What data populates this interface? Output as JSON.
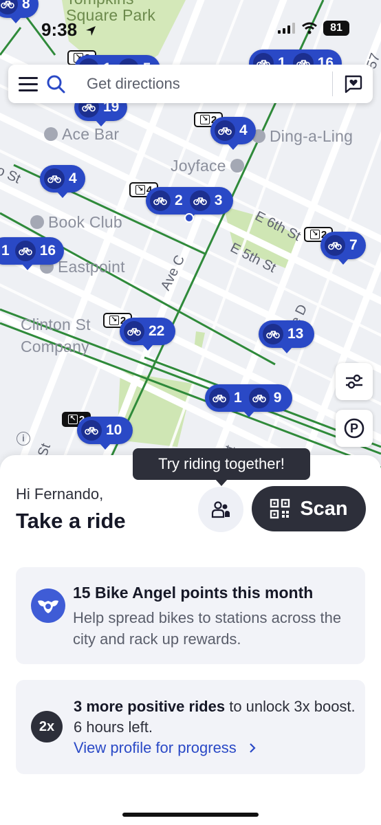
{
  "status_bar": {
    "time": "9:38",
    "battery": "81"
  },
  "search": {
    "placeholder": "Get directions"
  },
  "map": {
    "places": {
      "park": "Tompkins\nSquare Park",
      "ace_bar": "Ace Bar",
      "ding_a_ling": "Ding-a-Ling",
      "joyface": "Joyface",
      "book_club": "Book Club",
      "eastpoint": "Eastpoint",
      "clinton_1": "Clinton St",
      "clinton_2": "Company"
    },
    "streets": {
      "e6th": "E 6th St",
      "e5th": "E 5th St",
      "avec": "Ave C",
      "aved": "ve D",
      "st_left": "o St",
      "st_bottom1": "e St",
      "st_bottom2": "St",
      "s7": "57"
    },
    "stations": [
      {
        "id": "tl",
        "counts": [
          "8"
        ]
      },
      {
        "id": "top",
        "badge": "2",
        "counts": [
          "1",
          "5"
        ]
      },
      {
        "id": "topright",
        "counts": [
          "1",
          "16"
        ]
      },
      {
        "id": "s19",
        "counts": [
          "19"
        ]
      },
      {
        "id": "s4a",
        "badge": "2",
        "counts": [
          "4"
        ]
      },
      {
        "id": "s4b",
        "counts": [
          "4"
        ]
      },
      {
        "id": "s23",
        "badge": "4",
        "counts": [
          "2",
          "3"
        ]
      },
      {
        "id": "s16",
        "counts": [
          "1",
          "16"
        ]
      },
      {
        "id": "s7",
        "badge": "2",
        "counts": [
          "7"
        ]
      },
      {
        "id": "s22",
        "badge": "2",
        "counts": [
          "22"
        ]
      },
      {
        "id": "s13",
        "counts": [
          "13"
        ]
      },
      {
        "id": "s19b",
        "counts": [
          "1",
          "9"
        ]
      },
      {
        "id": "s10",
        "badge": "2",
        "counts": [
          "10"
        ]
      }
    ]
  },
  "sheet": {
    "tooltip": "Try riding together!",
    "greeting": "Hi Fernando,",
    "title": "Take a ride",
    "scan_label": "Scan",
    "angel_card": {
      "title": "15 Bike Angel points this month",
      "body": "Help spread bikes to stations across the city and rack up rewards."
    },
    "boost_card": {
      "badge": "2x",
      "bold": "3 more positive rides",
      "text": " to unlock 3x boost. 6 hours left.",
      "link": "View profile for progress"
    }
  }
}
